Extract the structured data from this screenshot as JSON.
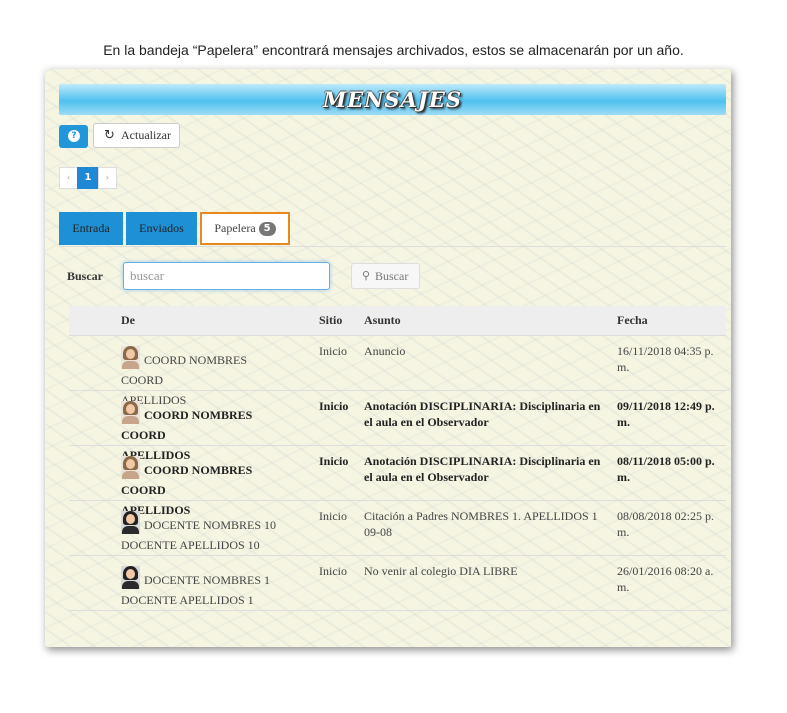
{
  "caption": "En la bandeja “Papelera” encontrará mensajes archivados, estos se almacenarán por un año.",
  "banner": {
    "title": "MENSAJES"
  },
  "toolbar": {
    "help_icon": "question-circle-icon",
    "refresh_icon": "refresh-icon",
    "refresh_label": "Actualizar"
  },
  "pagination": {
    "prev": "‹",
    "current": "1",
    "next": "›"
  },
  "tabs": [
    {
      "label": "Entrada"
    },
    {
      "label": "Enviados"
    },
    {
      "label": "Papelera",
      "badge": "5",
      "active": true
    }
  ],
  "search": {
    "label": "Buscar",
    "placeholder": "buscar",
    "button_label": "Buscar",
    "button_icon": "search-icon"
  },
  "table": {
    "headers": {
      "de": "De",
      "sitio": "Sitio",
      "asunto": "Asunto",
      "fecha": "Fecha"
    },
    "rows": [
      {
        "de_line1": "COORD NOMBRES COORD",
        "de_line2": "APELLIDOS",
        "sitio": "Inicio",
        "asunto": "Anuncio",
        "fecha": "16/11/2018 04:35 p. m.",
        "bold": false
      },
      {
        "de_line1": "COORD NOMBRES COORD",
        "de_line2": "APELLIDOS",
        "sitio": "Inicio",
        "asunto": "Anotación DISCIPLINARIA: Disciplinaria en el aula en el Observador",
        "fecha": "09/11/2018 12:49 p. m.",
        "bold": true
      },
      {
        "de_line1": "COORD NOMBRES COORD",
        "de_line2": "APELLIDOS",
        "sitio": "Inicio",
        "asunto": "Anotación DISCIPLINARIA: Disciplinaria en el aula en el Observador",
        "fecha": "08/11/2018 05:00 p. m.",
        "bold": true
      },
      {
        "de_line1": "DOCENTE NOMBRES 10",
        "de_line2": "DOCENTE APELLIDOS 10",
        "sitio": "Inicio",
        "asunto": "Citación a Padres NOMBRES 1. APELLIDOS 1 09-08",
        "fecha": "08/08/2018 02:25 p. m.",
        "bold": false
      },
      {
        "de_line1": "DOCENTE NOMBRES 1",
        "de_line2": "DOCENTE APELLIDOS 1",
        "sitio": "Inicio",
        "asunto": "No venir al colegio DIA LIBRE",
        "fecha": "26/01/2016 08:20 a. m.",
        "bold": false
      }
    ]
  }
}
